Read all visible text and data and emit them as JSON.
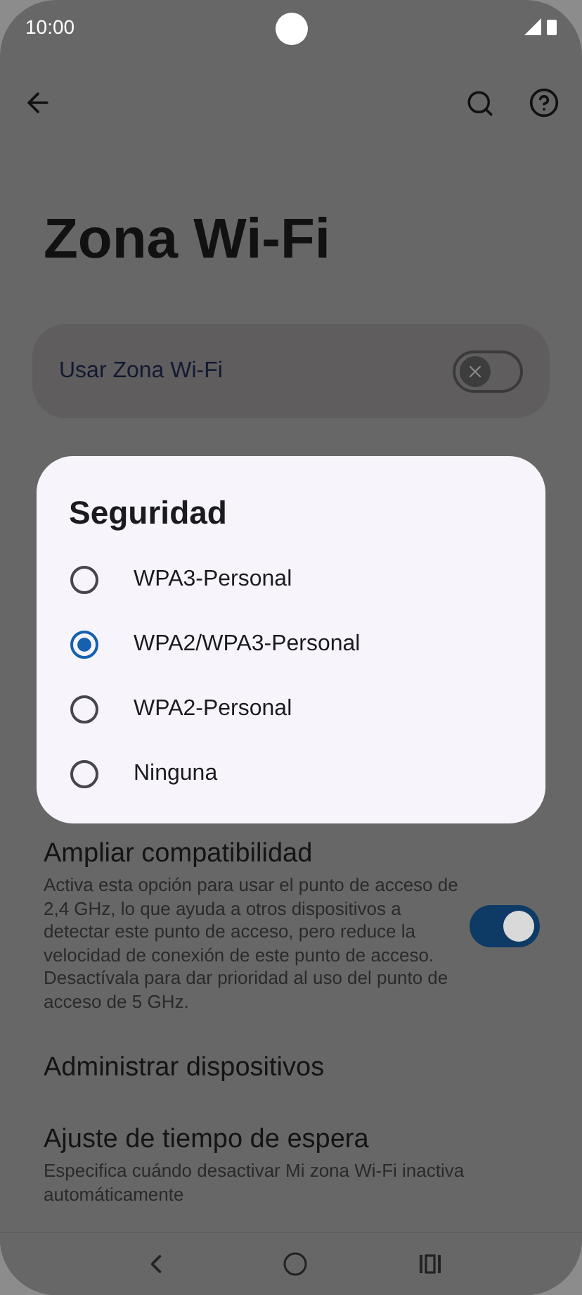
{
  "status_bar": {
    "time": "10:00"
  },
  "title": "Zona Wi-Fi",
  "main_toggle": {
    "label": "Usar Zona Wi-Fi",
    "on": false
  },
  "settings": [
    {
      "kind": "switch",
      "title": "Ampliar compatibilidad",
      "summary": "Activa esta opción para usar el punto de acceso de 2,4 GHz, lo que ayuda a otros dispositivos a detectar este punto de acceso, pero reduce la velocidad de conexión de este punto de acceso. Desactívala para dar prioridad al uso del punto de acceso de 5 GHz.",
      "on": true
    },
    {
      "kind": "plain",
      "title": "Administrar dispositivos"
    },
    {
      "kind": "plain",
      "title": "Ajuste de tiempo de espera",
      "summary": "Especifica cuándo desactivar Mi zona Wi-Fi inactiva",
      "hidden_line": "automáticamente"
    }
  ],
  "dialog": {
    "title": "Seguridad",
    "options": [
      {
        "label": "WPA3-Personal",
        "selected": false
      },
      {
        "label": "WPA2/WPA3-Personal",
        "selected": true
      },
      {
        "label": "WPA2-Personal",
        "selected": false
      },
      {
        "label": "Ninguna",
        "selected": false
      }
    ]
  }
}
